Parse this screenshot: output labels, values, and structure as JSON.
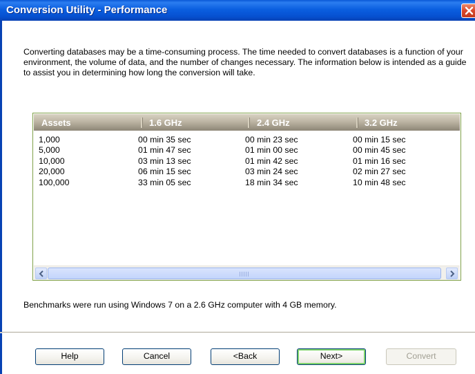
{
  "window": {
    "title": "Conversion Utility - Performance",
    "close_icon": "close-icon"
  },
  "intro": "Converting databases may be a time-consuming process. The time needed to convert databases is a function of your environment, the volume of data, and the number of changes necessary. The information below is intended as a guide to assist you in determining how long the conversion will take.",
  "table": {
    "columns": [
      "Assets",
      "1.6 GHz",
      "2.4 GHz",
      "3.2 GHz"
    ],
    "rows": [
      [
        "1,000",
        "00 min 35 sec",
        "00 min 23 sec",
        "00 min 15 sec"
      ],
      [
        "5,000",
        "01 min 47 sec",
        "01 min 00 sec",
        "00 min 45 sec"
      ],
      [
        "10,000",
        "03 min 13 sec",
        "01 min 42 sec",
        "01 min 16 sec"
      ],
      [
        "20,000",
        "06 min 15 sec",
        "03 min 24 sec",
        "02 min 27 sec"
      ],
      [
        "100,000",
        "33 min 05 sec",
        "18 min 34 sec",
        "10 min 48 sec"
      ]
    ]
  },
  "benchmark_note": "Benchmarks were run using Windows 7 on a 2.6 GHz computer with 4 GB memory.",
  "buttons": {
    "help": "Help",
    "cancel": "Cancel",
    "back": "<Back",
    "next": "Next>",
    "convert": "Convert"
  },
  "colors": {
    "titlebar": "#0b5fe0",
    "listbox_border": "#7fa048",
    "header_bg": "#bdb5a4"
  }
}
